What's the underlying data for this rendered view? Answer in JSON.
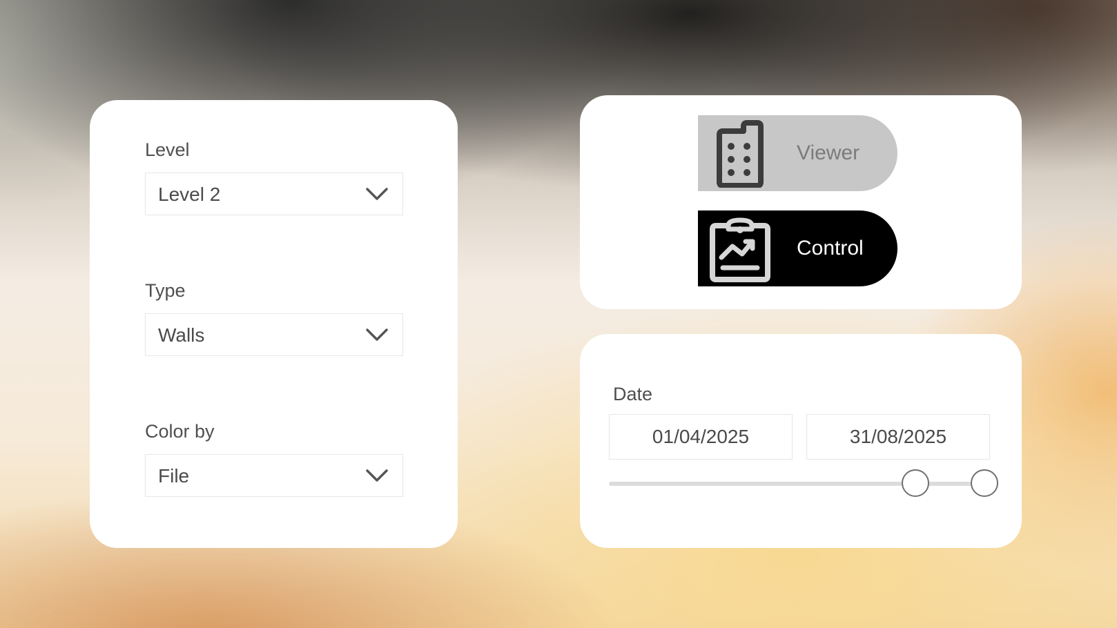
{
  "filters": {
    "level": {
      "label": "Level",
      "value": "Level 2"
    },
    "type": {
      "label": "Type",
      "value": "Walls"
    },
    "color_by": {
      "label": "Color by",
      "value": "File"
    }
  },
  "modes": {
    "viewer": {
      "label": "Viewer",
      "icon": "building-icon",
      "selected": false
    },
    "control": {
      "label": "Control",
      "icon": "clipboard-chart-icon",
      "selected": true
    }
  },
  "date_range": {
    "label": "Date",
    "start": "01/04/2025",
    "end": "31/08/2025",
    "slider": {
      "start_fraction": 0.8,
      "end_fraction": 0.98
    }
  },
  "colors": {
    "card_background": "#ffffff",
    "text": "#4f4f4f",
    "viewer_background": "#c7c7c7",
    "control_background": "#000000"
  }
}
